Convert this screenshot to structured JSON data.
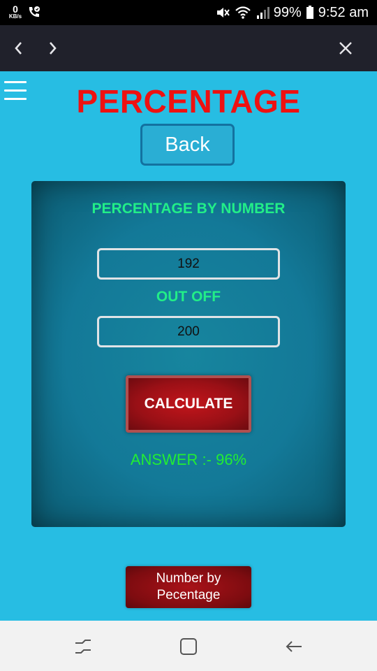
{
  "status_bar": {
    "speed_value": "0",
    "speed_unit": "KB/s",
    "battery": "99%",
    "time": "9:52 am",
    "icons": [
      "call-icon",
      "mute-icon",
      "wifi-icon",
      "signal-icon",
      "battery-icon"
    ]
  },
  "browser_bar": {
    "icons": [
      "back-arrow-icon",
      "forward-arrow-icon",
      "close-icon"
    ]
  },
  "header": {
    "title": "PERCENTAGE",
    "back_label": "Back",
    "menu_icon": "hamburger-menu-icon"
  },
  "card": {
    "heading": "PERCENTAGE BY NUMBER",
    "number_value": "192",
    "out_off_label": "OUT OFF",
    "total_value": "200",
    "calculate_label": "CALCULATE",
    "answer": "ANSWER :- 96%"
  },
  "footer": {
    "number_by_percentage_label": "Number by Pecentage"
  },
  "system_nav": {
    "icons": [
      "recent-apps-icon",
      "home-icon",
      "back-icon"
    ]
  },
  "colors": {
    "page_background": "#27bde3",
    "title_red": "#ee1111",
    "card_teal": "#137998",
    "heading_green": "#22ee88",
    "answer_green": "#22ee33",
    "button_red": "#9a1016"
  }
}
